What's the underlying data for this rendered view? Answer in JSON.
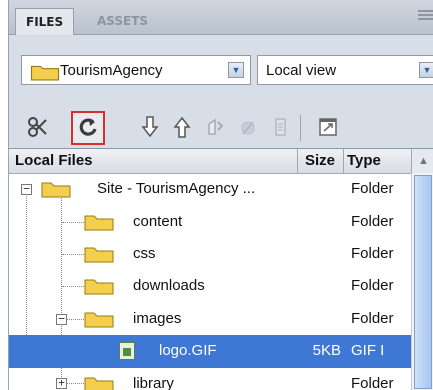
{
  "tabs": [
    {
      "label": "FILES",
      "active": true
    },
    {
      "label": "ASSETS",
      "active": false
    }
  ],
  "site_select": {
    "value": "TourismAgency"
  },
  "view_select": {
    "value": "Local view"
  },
  "toolbar": {
    "buttons": [
      "connect-icon",
      "refresh-icon",
      "get-icon",
      "put-icon",
      "checkout-icon",
      "checkin-icon",
      "sync-icon",
      "expand-icon"
    ]
  },
  "columns": {
    "local_files": "Local Files",
    "size": "Size",
    "type": "Type"
  },
  "rows": [
    {
      "name": "Site - TourismAgency ...",
      "size": "",
      "type": "Folder"
    },
    {
      "name": "content",
      "size": "",
      "type": "Folder"
    },
    {
      "name": "css",
      "size": "",
      "type": "Folder"
    },
    {
      "name": "downloads",
      "size": "",
      "type": "Folder"
    },
    {
      "name": "images",
      "size": "",
      "type": "Folder"
    },
    {
      "name": "logo.GIF",
      "size": "5KB",
      "type": "GIF I"
    },
    {
      "name": "library",
      "size": "",
      "type": "Folder"
    }
  ],
  "colors": {
    "selection": "#3f78d4",
    "highlight_border": "#d6302d",
    "folder": "#e8c23b"
  }
}
